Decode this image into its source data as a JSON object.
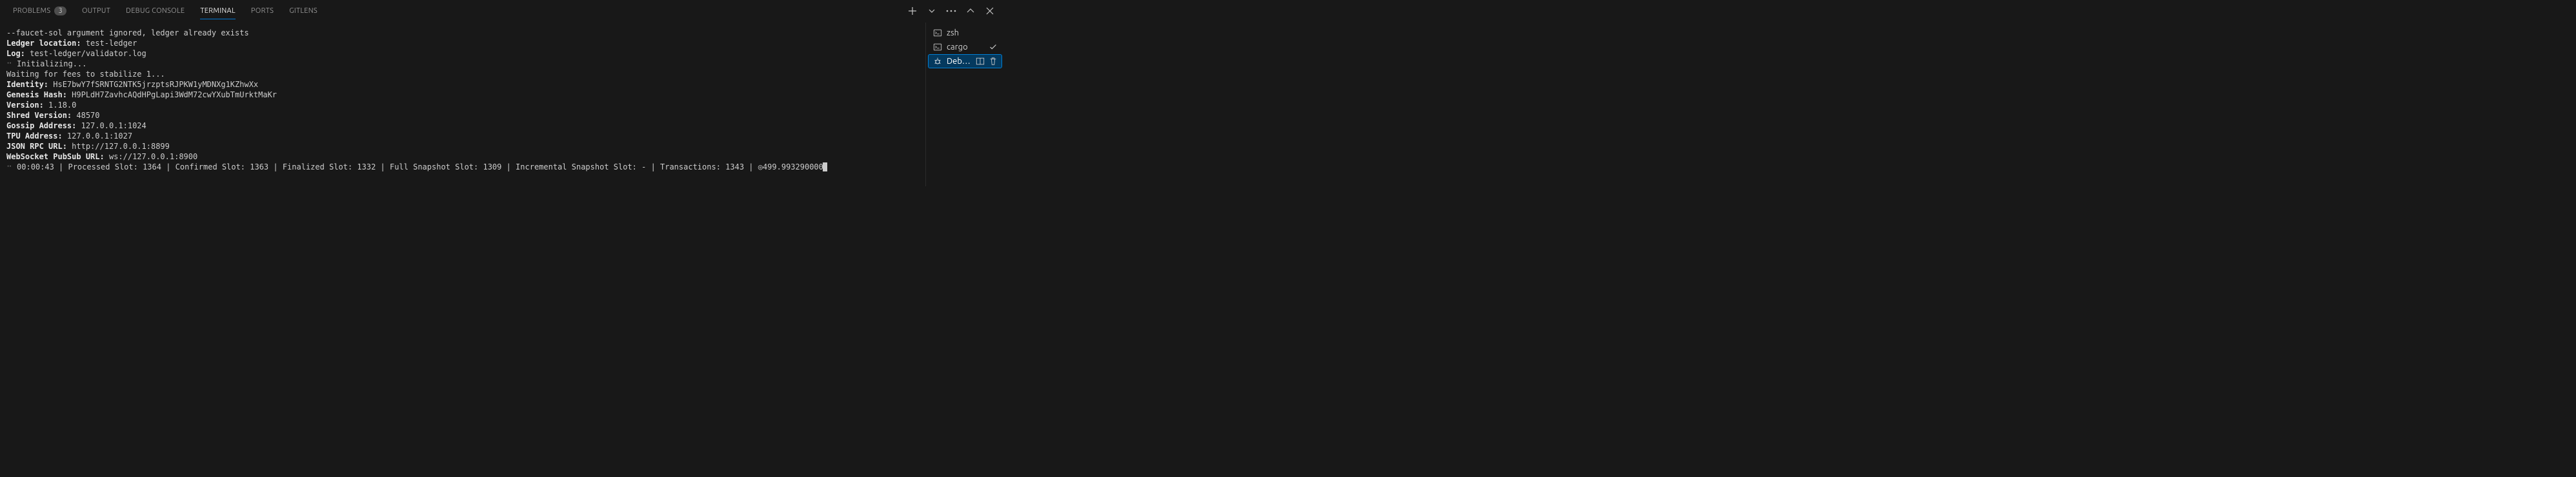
{
  "tabs": {
    "problems": {
      "label": "Problems",
      "badge": "3"
    },
    "output": {
      "label": "Output"
    },
    "debug_console": {
      "label": "Debug Console"
    },
    "terminal": {
      "label": "Terminal"
    },
    "ports": {
      "label": "Ports"
    },
    "gitlens": {
      "label": "GitLens"
    }
  },
  "terminal": {
    "lines": {
      "l1": "--faucet-sol argument ignored, ledger already exists",
      "l2_label": "Ledger location:",
      "l2_value": " test-ledger",
      "l3_label": "Log:",
      "l3_value": " test-ledger/validator.log",
      "l4_prefix": "⠒ ",
      "l4_text": "Initializing...",
      "l5": "Waiting for fees to stabilize 1...",
      "l6_label": "Identity:",
      "l6_value": " HsE7bwY7fSRNTG2NTK5jrzptsRJPKW1yMDNXg1KZhwXx",
      "l7_label": "Genesis Hash:",
      "l7_value": " H9PLdH7ZavhcAQdHPgLapi3WdM72cwYXubTmUrktMaKr",
      "l8_label": "Version:",
      "l8_value": " 1.18.0",
      "l9_label": "Shred Version:",
      "l9_value": " 48570",
      "l10_label": "Gossip Address:",
      "l10_value": " 127.0.0.1:1024",
      "l11_label": "TPU Address:",
      "l11_value": " 127.0.0.1:1027",
      "l12_label": "JSON RPC URL:",
      "l12_value": " http://127.0.0.1:8899",
      "l13_label": "WebSocket PubSub URL:",
      "l13_value": " ws://127.0.0.1:8900",
      "l14_prefix": "⠒ ",
      "l14_text": "00:00:43 | Processed Slot: 1364 | Confirmed Slot: 1363 | Finalized Slot: 1332 | Full Snapshot Slot: 1309 | Incremental Snapshot Slot: - | Transactions: 1343 | ◎499.993290000"
    }
  },
  "sidebar": {
    "items": [
      {
        "label": "zsh",
        "status": ""
      },
      {
        "label": "cargo",
        "status": "success"
      },
      {
        "label": "Deb…",
        "status": "active"
      }
    ]
  }
}
